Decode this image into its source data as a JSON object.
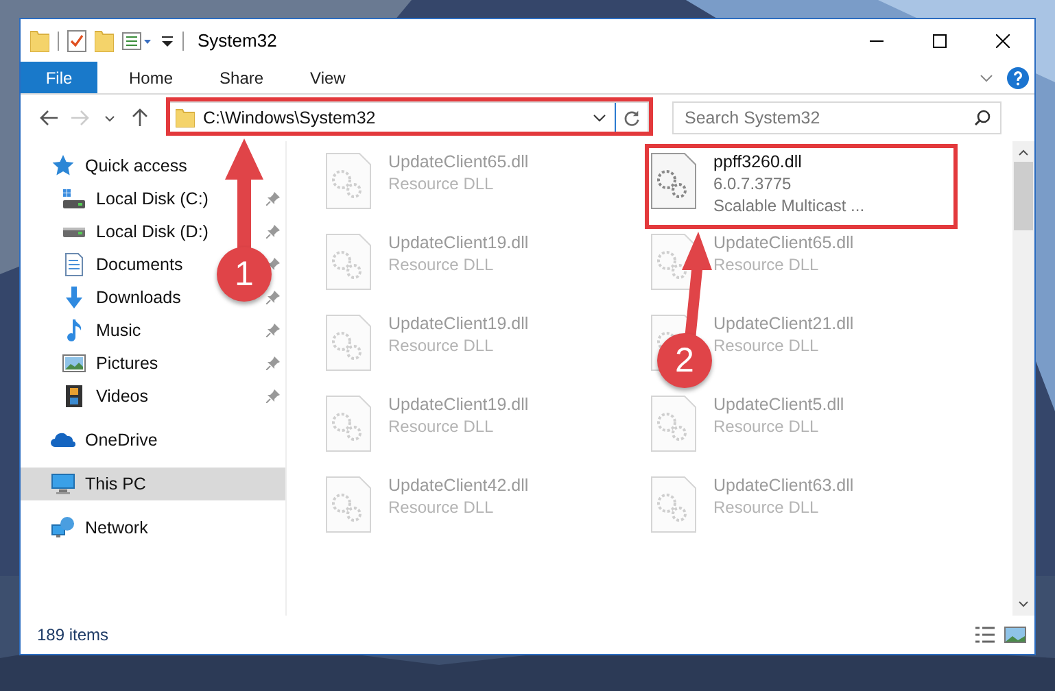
{
  "window": {
    "title": "System32"
  },
  "ribbon": {
    "tabs": [
      {
        "label": "File",
        "kind": "file"
      },
      {
        "label": "Home",
        "kind": "tab"
      },
      {
        "label": "Share",
        "kind": "tab"
      },
      {
        "label": "View",
        "kind": "tab"
      }
    ]
  },
  "address_bar": {
    "path": "C:\\Windows\\System32"
  },
  "search": {
    "placeholder": "Search System32"
  },
  "navigation": [
    {
      "label": "Quick access",
      "kind": "star",
      "selected": false,
      "children": [
        {
          "label": "Local Disk (C:)",
          "kind": "disk-c",
          "pinned": true
        },
        {
          "label": "Local Disk (D:)",
          "kind": "disk",
          "pinned": true
        },
        {
          "label": "Documents",
          "kind": "documents",
          "pinned": true
        },
        {
          "label": "Downloads",
          "kind": "downloads",
          "pinned": true
        },
        {
          "label": "Music",
          "kind": "music",
          "pinned": true
        },
        {
          "label": "Pictures",
          "kind": "pictures",
          "pinned": true
        },
        {
          "label": "Videos",
          "kind": "videos",
          "pinned": true
        }
      ]
    },
    {
      "label": "OneDrive",
      "kind": "cloud",
      "selected": false
    },
    {
      "label": "This PC",
      "kind": "computer",
      "selected": true
    },
    {
      "label": "Network",
      "kind": "network",
      "selected": false
    }
  ],
  "files": [
    {
      "name": "UpdateClient65.dll",
      "details": [
        "Resource DLL"
      ],
      "blurred": true
    },
    {
      "name": "ppff3260.dll",
      "details": [
        "6.0.7.3775",
        "Scalable Multicast ..."
      ],
      "blurred": false
    },
    {
      "name": "UpdateClient19.dll",
      "details": [
        "Resource DLL"
      ],
      "blurred": true
    },
    {
      "name": "UpdateClient65.dll",
      "details": [
        "Resource DLL"
      ],
      "blurred": true
    },
    {
      "name": "UpdateClient19.dll",
      "details": [
        "Resource DLL"
      ],
      "blurred": true
    },
    {
      "name": "UpdateClient21.dll",
      "details": [
        "Resource DLL"
      ],
      "blurred": true
    },
    {
      "name": "UpdateClient19.dll",
      "details": [
        "Resource DLL"
      ],
      "blurred": true
    },
    {
      "name": "UpdateClient5.dll",
      "details": [
        "Resource DLL"
      ],
      "blurred": true
    },
    {
      "name": "UpdateClient42.dll",
      "details": [
        "Resource DLL"
      ],
      "blurred": true
    },
    {
      "name": "UpdateClient63.dll",
      "details": [
        "Resource DLL"
      ],
      "blurred": true
    }
  ],
  "status_bar": {
    "item_count": "189 items"
  },
  "annotations": [
    {
      "label": "1"
    },
    {
      "label": "2"
    }
  ]
}
